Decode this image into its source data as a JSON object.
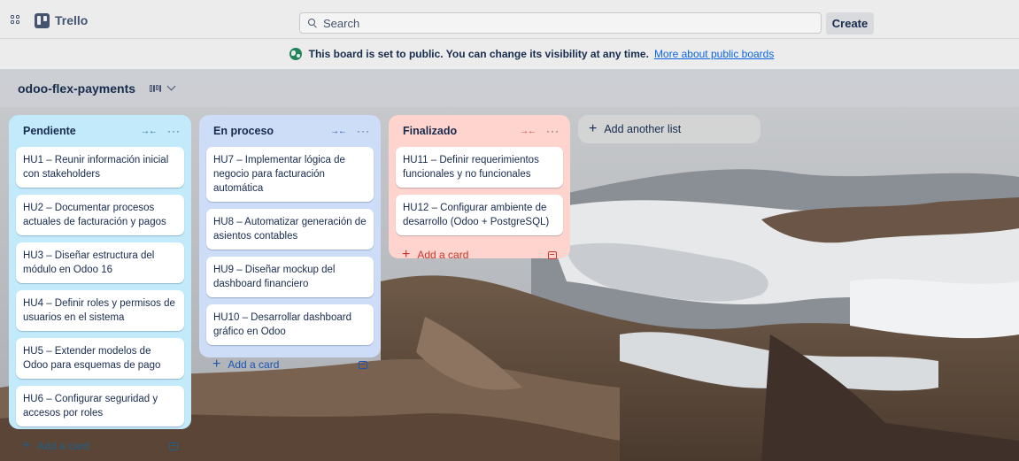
{
  "topbar": {
    "app_name": "Trello",
    "search_placeholder": "Search",
    "create_label": "Create"
  },
  "banner": {
    "message": "This board is set to public. You can change its visibility at any time.",
    "link_text": "More about public boards"
  },
  "board": {
    "title": "odoo-flex-payments"
  },
  "lists": [
    {
      "title": "Pendiente",
      "color": "#c2eafb",
      "cards": [
        "HU1 – Reunir información inicial con stakeholders",
        "HU2 – Documentar procesos actuales de facturación y pagos",
        "HU3 – Diseñar estructura del módulo en Odoo 16",
        "HU4 – Definir roles y permisos de usuarios en el sistema",
        "HU5 – Extender modelos de Odoo para esquemas de pago",
        "HU6 – Configurar seguridad y accesos por roles"
      ],
      "add_card_label": "Add a card"
    },
    {
      "title": "En proceso",
      "color": "#cddcf7",
      "cards": [
        "HU7 – Implementar lógica de negocio para facturación automática",
        "HU8 – Automatizar generación de asientos contables",
        "HU9 – Diseñar mockup del dashboard financiero",
        "HU10 – Desarrollar dashboard gráfico en Odoo"
      ],
      "add_card_label": "Add a card"
    },
    {
      "title": "Finalizado",
      "color": "#ffd4cf",
      "cards": [
        "HU11 – Definir requerimientos funcionales y no funcionales",
        "HU12 – Configurar ambiente de desarrollo (Odoo + PostgreSQL)"
      ],
      "add_card_label": "Add a card"
    }
  ],
  "add_list_label": "Add another list",
  "icons": {
    "apps": "apps-grid-icon",
    "logo": "trello-logo-icon",
    "search": "search-icon",
    "globe": "globe-icon",
    "views": "board-views-icon",
    "chevron": "chevron-down-icon",
    "collapse": "collapse-list-icon",
    "more": "more-icon",
    "plus": "plus-icon",
    "template": "card-template-icon"
  },
  "colors": {
    "link": "#0c66e4",
    "public_globe": "#1f845a"
  }
}
